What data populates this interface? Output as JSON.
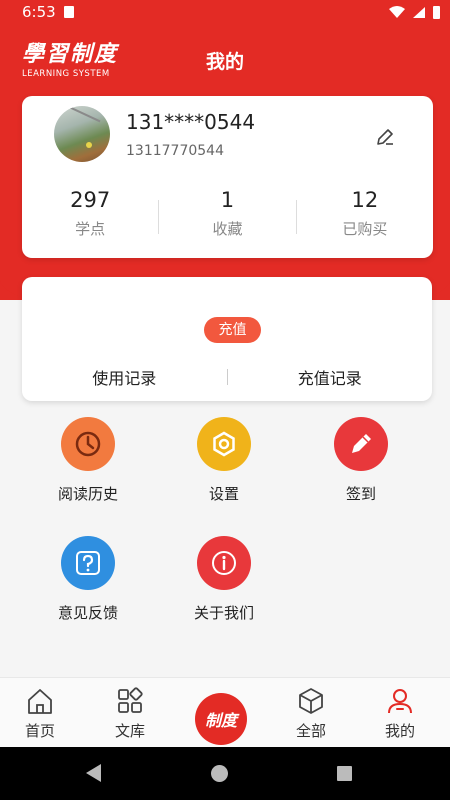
{
  "status_bar": {
    "time": "6:53"
  },
  "header": {
    "logo_cn": "學習制度",
    "logo_en": "LEARNING SYSTEM",
    "title": "我的"
  },
  "profile": {
    "username": "131****0544",
    "phone": "13117770544",
    "stats": [
      {
        "value": "297",
        "label": "学点"
      },
      {
        "value": "1",
        "label": "收藏"
      },
      {
        "value": "12",
        "label": "已购买"
      }
    ]
  },
  "recharge": {
    "badge": "充值",
    "tabs": [
      "使用记录",
      "充值记录"
    ]
  },
  "menu": [
    {
      "label": "阅读历史",
      "icon": "clock-icon",
      "color": "#f27a3f"
    },
    {
      "label": "设置",
      "icon": "settings-icon",
      "color": "#f0b31a"
    },
    {
      "label": "签到",
      "icon": "pencil-icon",
      "color": "#e8383b"
    },
    {
      "label": "意见反馈",
      "icon": "question-icon",
      "color": "#2f8fe0"
    },
    {
      "label": "关于我们",
      "icon": "info-icon",
      "color": "#e8383b"
    }
  ],
  "bottom_nav": {
    "items": [
      "首页",
      "文库",
      "全部",
      "我的"
    ],
    "center_label": "制度"
  },
  "colors": {
    "brand_red": "#e32b25"
  }
}
